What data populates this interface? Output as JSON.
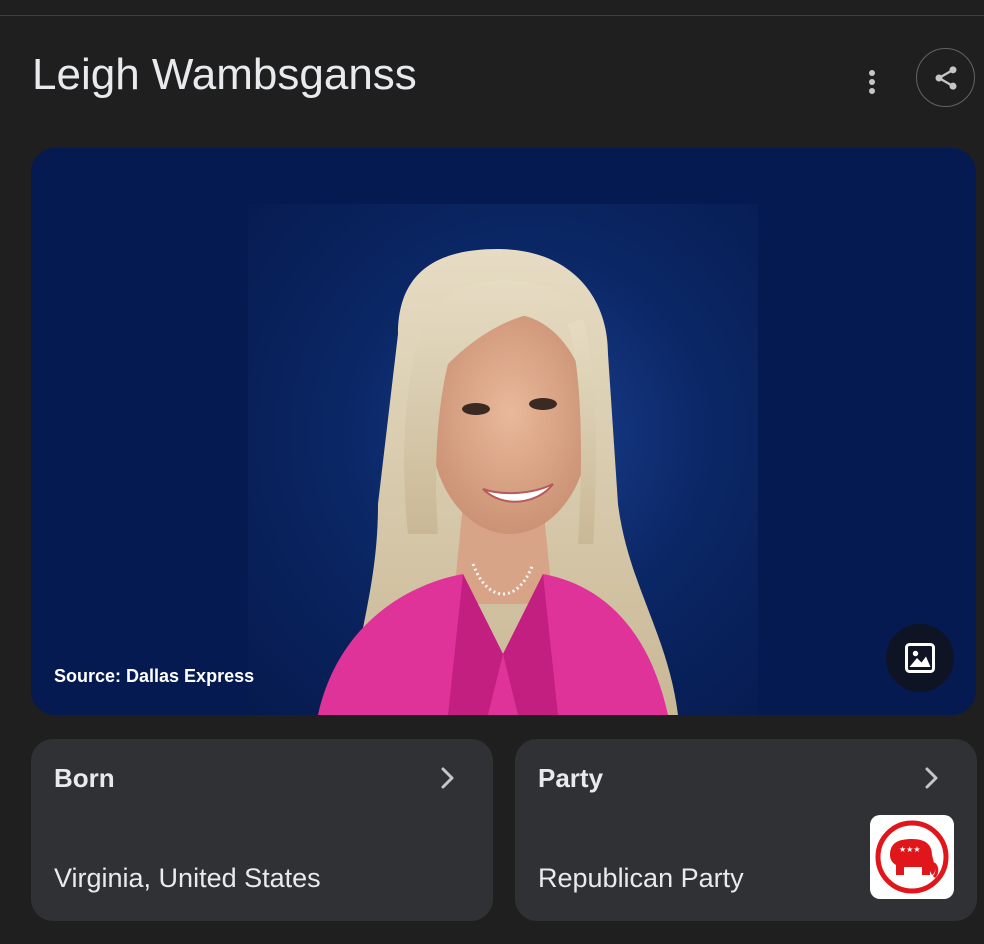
{
  "header": {
    "title": "Leigh Wambsganss"
  },
  "hero": {
    "source_text": "Source: Dallas Express"
  },
  "cards": {
    "born": {
      "label": "Born",
      "value": "Virginia, United States"
    },
    "party": {
      "label": "Party",
      "value": "Republican Party"
    }
  },
  "icons": {
    "more": "more-vert-icon",
    "share": "share-icon",
    "image": "image-icon",
    "chevron": "chevron-right-icon",
    "party_logo": "republican-elephant-logo"
  },
  "colors": {
    "background": "#1f1f1f",
    "card": "#303134",
    "text": "#e8eaed",
    "hero_bg": "#061a52",
    "republican_red": "#e0161b"
  }
}
